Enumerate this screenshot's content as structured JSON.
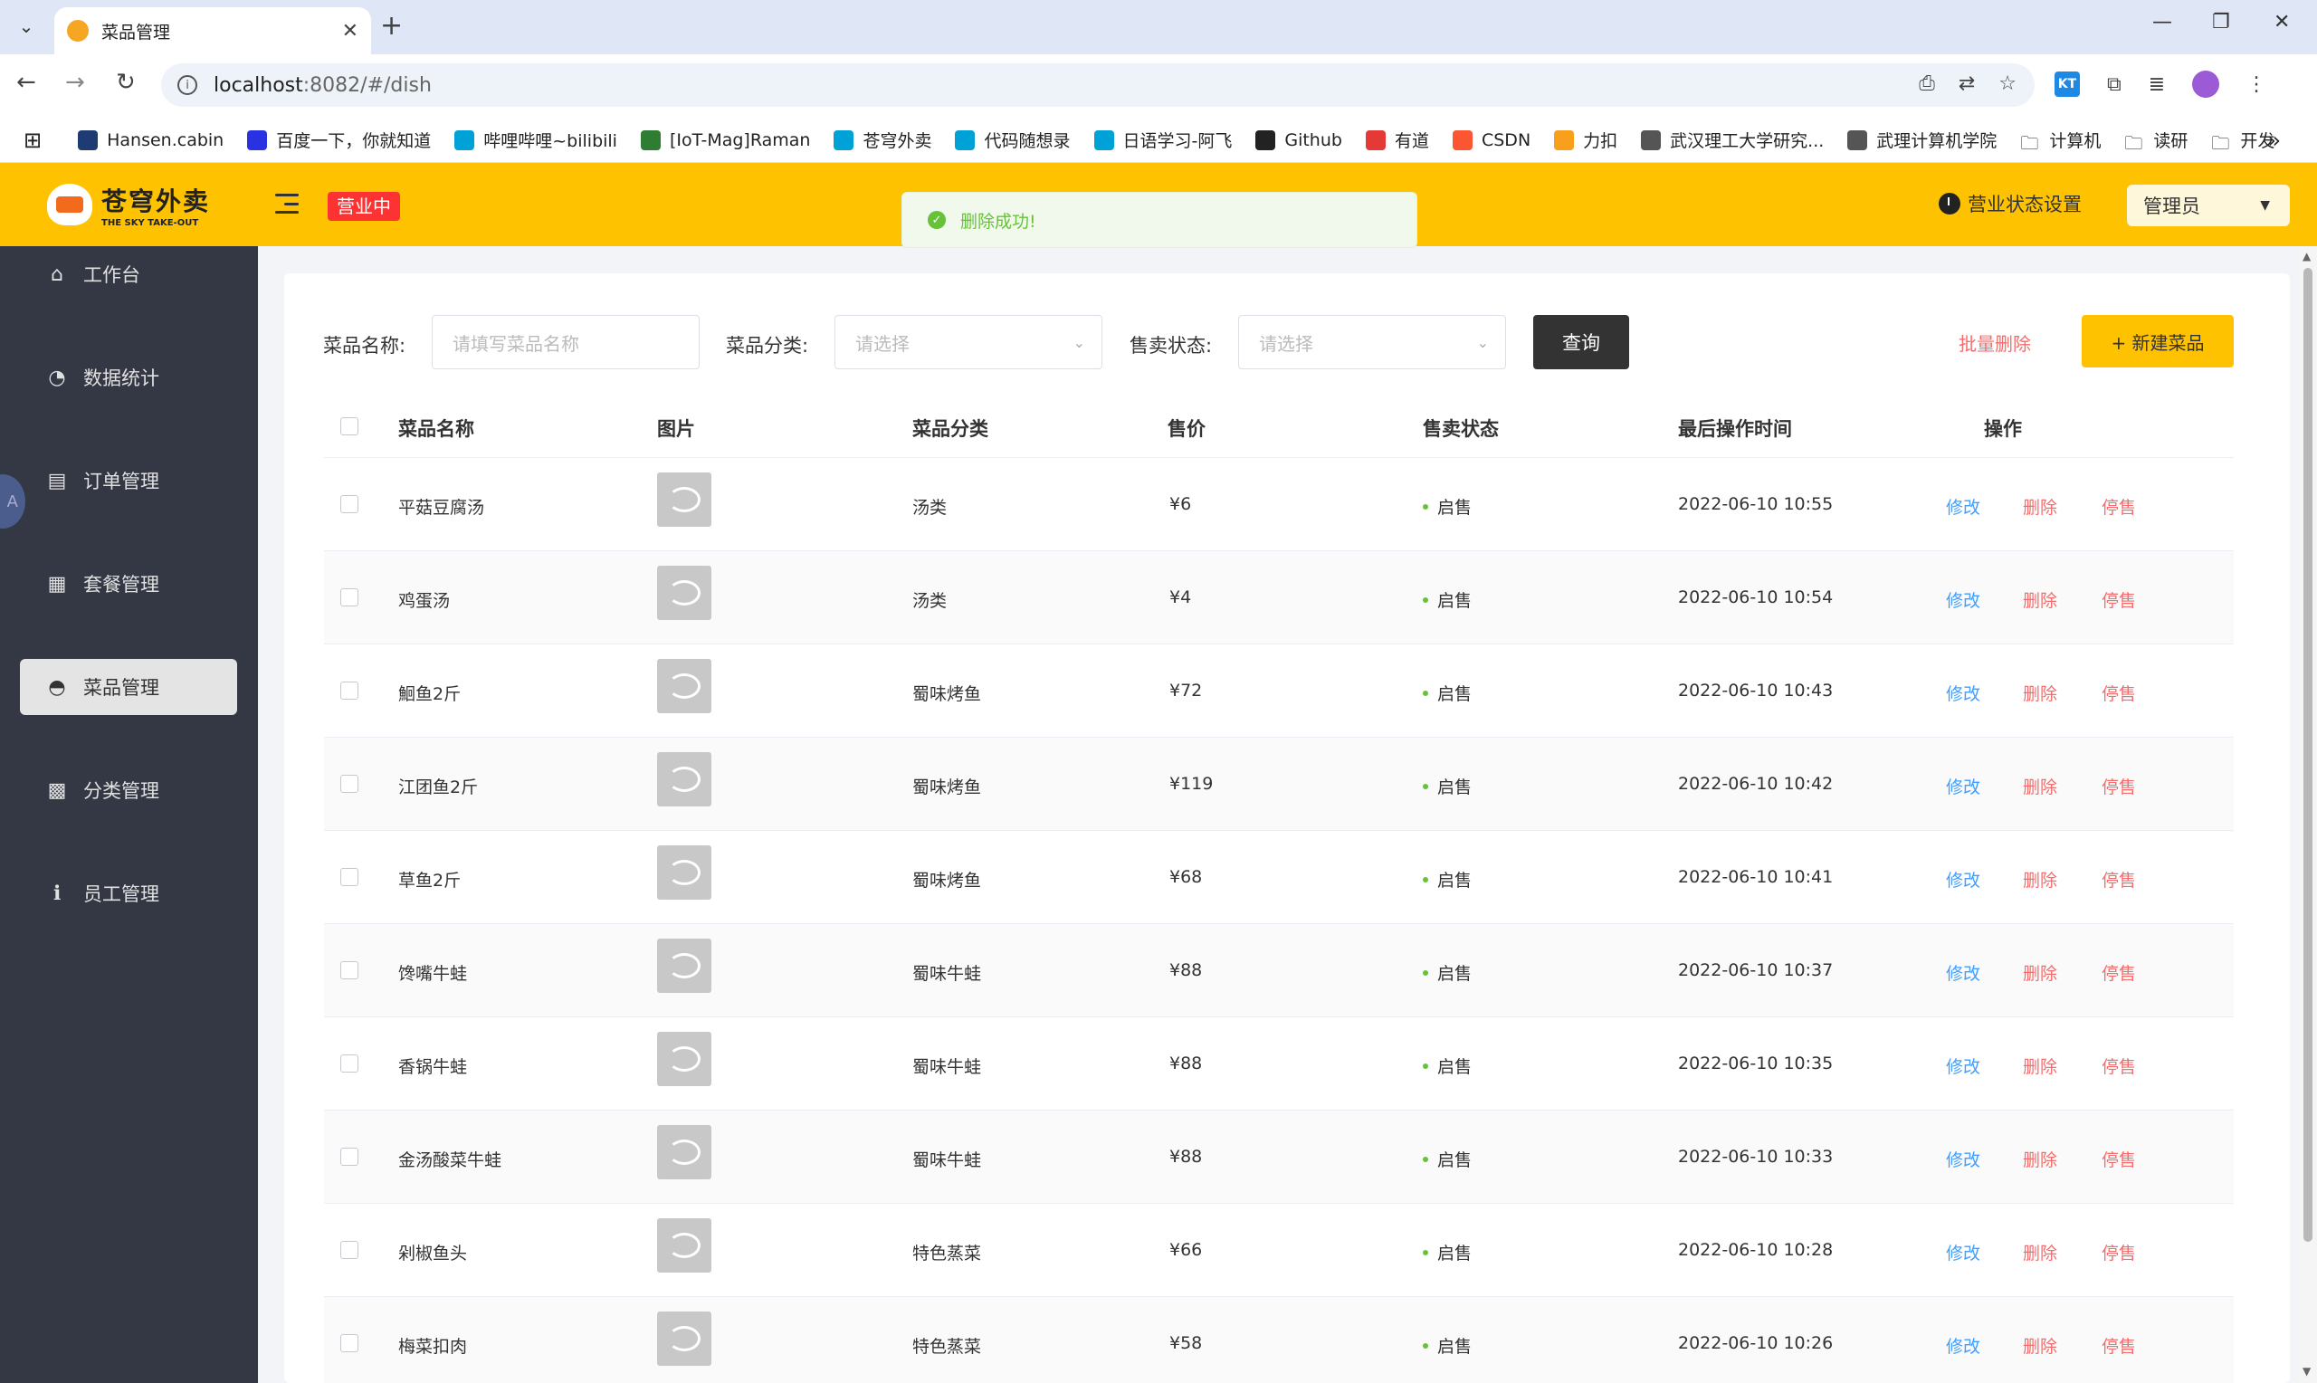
{
  "browser": {
    "tab_title": "菜品管理",
    "url_host": "localhost",
    "url_rest": ":8082/#/dish",
    "bookmarks": [
      {
        "label": "Hansen.cabin",
        "color": "#1f3b73"
      },
      {
        "label": "百度一下，你就知道",
        "color": "#2932e1"
      },
      {
        "label": "哔哩哔哩~bilibili",
        "color": "#00a1d6"
      },
      {
        "label": "[IoT-Mag]Raman",
        "color": "#2e7d32"
      },
      {
        "label": "苍穹外卖",
        "color": "#00a1d6"
      },
      {
        "label": "代码随想录",
        "color": "#00a1d6"
      },
      {
        "label": "日语学习-阿飞",
        "color": "#00a1d6"
      },
      {
        "label": "Github",
        "color": "#222222"
      },
      {
        "label": "有道",
        "color": "#e53935"
      },
      {
        "label": "CSDN",
        "color": "#fc5531"
      },
      {
        "label": "力扣",
        "color": "#f89f1b"
      },
      {
        "label": "武汉理工大学研究...",
        "color": "#555555"
      },
      {
        "label": "武理计算机学院",
        "color": "#555555"
      },
      {
        "label": "计算机",
        "color": "folder"
      },
      {
        "label": "读研",
        "color": "folder"
      },
      {
        "label": "开发",
        "color": "folder"
      }
    ]
  },
  "header": {
    "logo_cn": "苍穹外卖",
    "logo_en": "THE SKY TAKE-OUT",
    "status_badge": "营业中",
    "toast": "删除成功!",
    "status_setting": "营业状态设置",
    "user": "管理员",
    "accent": "#ffc200"
  },
  "sidebar": {
    "items": [
      {
        "label": "工作台",
        "icon": "home-icon",
        "glyph": "⌂"
      },
      {
        "label": "数据统计",
        "icon": "chart-icon",
        "glyph": "◔"
      },
      {
        "label": "订单管理",
        "icon": "order-icon",
        "glyph": "▤"
      },
      {
        "label": "套餐管理",
        "icon": "gift-icon",
        "glyph": "▦"
      },
      {
        "label": "菜品管理",
        "icon": "dish-icon",
        "glyph": "◓",
        "active": true
      },
      {
        "label": "分类管理",
        "icon": "category-icon",
        "glyph": "▩"
      },
      {
        "label": "员工管理",
        "icon": "info-icon",
        "glyph": "ℹ"
      }
    ]
  },
  "filters": {
    "name_label": "菜品名称:",
    "name_placeholder": "请填写菜品名称",
    "category_label": "菜品分类:",
    "category_placeholder": "请选择",
    "status_label": "售卖状态:",
    "status_placeholder": "请选择",
    "query_button": "查询",
    "batch_delete": "批量删除",
    "new_button": "+ 新建菜品"
  },
  "table": {
    "columns": [
      "菜品名称",
      "图片",
      "菜品分类",
      "售价",
      "售卖状态",
      "最后操作时间",
      "操作"
    ],
    "actions": {
      "edit": "修改",
      "delete": "删除",
      "stop": "停售"
    },
    "rows": [
      {
        "name": "平菇豆腐汤",
        "category": "汤类",
        "price": "¥6",
        "status": "启售",
        "time": "2022-06-10 10:55"
      },
      {
        "name": "鸡蛋汤",
        "category": "汤类",
        "price": "¥4",
        "status": "启售",
        "time": "2022-06-10 10:54"
      },
      {
        "name": "鮰鱼2斤",
        "category": "蜀味烤鱼",
        "price": "¥72",
        "status": "启售",
        "time": "2022-06-10 10:43"
      },
      {
        "name": "江团鱼2斤",
        "category": "蜀味烤鱼",
        "price": "¥119",
        "status": "启售",
        "time": "2022-06-10 10:42"
      },
      {
        "name": "草鱼2斤",
        "category": "蜀味烤鱼",
        "price": "¥68",
        "status": "启售",
        "time": "2022-06-10 10:41"
      },
      {
        "name": "馋嘴牛蛙",
        "category": "蜀味牛蛙",
        "price": "¥88",
        "status": "启售",
        "time": "2022-06-10 10:37"
      },
      {
        "name": "香锅牛蛙",
        "category": "蜀味牛蛙",
        "price": "¥88",
        "status": "启售",
        "time": "2022-06-10 10:35"
      },
      {
        "name": "金汤酸菜牛蛙",
        "category": "蜀味牛蛙",
        "price": "¥88",
        "status": "启售",
        "time": "2022-06-10 10:33"
      },
      {
        "name": "剁椒鱼头",
        "category": "特色蒸菜",
        "price": "¥66",
        "status": "启售",
        "time": "2022-06-10 10:28"
      },
      {
        "name": "梅菜扣肉",
        "category": "特色蒸菜",
        "price": "¥58",
        "status": "启售",
        "time": "2022-06-10 10:26"
      }
    ]
  }
}
